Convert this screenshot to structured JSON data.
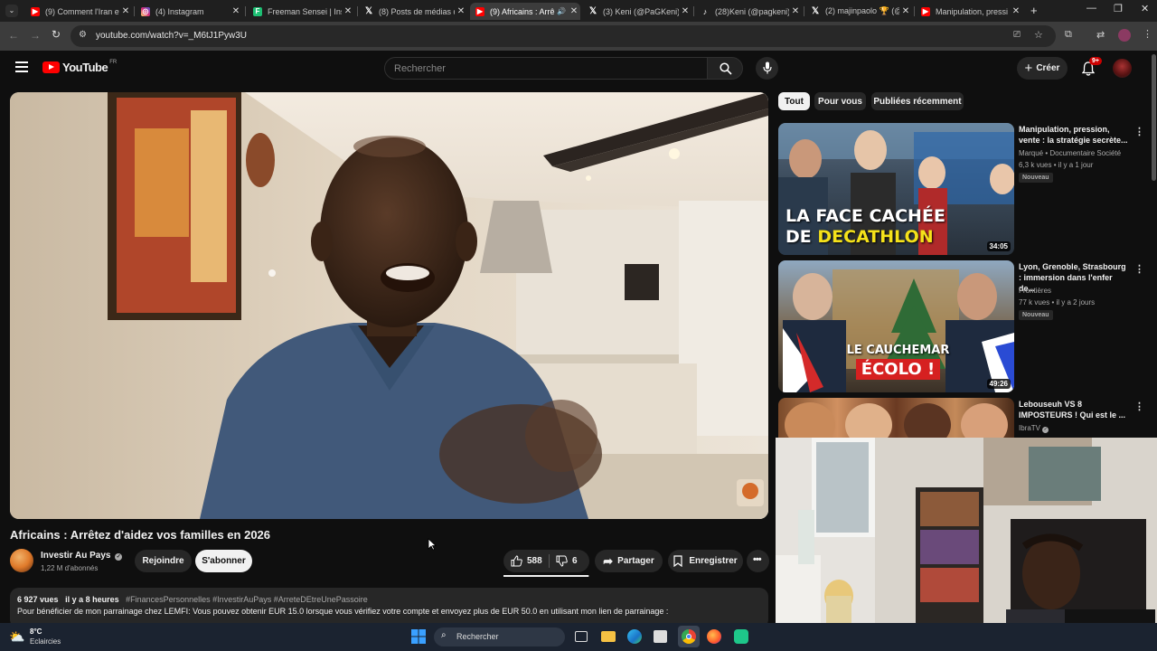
{
  "browser": {
    "tabs": [
      {
        "label": "(9) Comment l'Iran et",
        "icon": "youtube-icon",
        "color": "#ff0000"
      },
      {
        "label": "(4) Instagram",
        "icon": "instagram-icon",
        "color": "#d62976"
      },
      {
        "label": "Freeman Sensei | Inst",
        "icon": "green-app-icon",
        "color": "#1dbf73"
      },
      {
        "label": "(8) Posts de médias d",
        "icon": "x-icon",
        "color": "#000000"
      },
      {
        "label": "(9) Africains : Arrê",
        "icon": "youtube-icon",
        "color": "#ff0000"
      },
      {
        "label": "(3) Keni (@PaGKeni)",
        "icon": "x-icon",
        "color": "#000000"
      },
      {
        "label": "(28)Keni (@pagkeni)",
        "icon": "tiktok-icon",
        "color": "#000000"
      },
      {
        "label": "(2) majinpaolo 🏆 (@",
        "icon": "x-icon",
        "color": "#000000"
      },
      {
        "label": "Manipulation, pressi",
        "icon": "youtube-icon",
        "color": "#ff0000"
      }
    ],
    "url": "youtube.com/watch?v=_M6tJ1Pyw3U"
  },
  "youtube": {
    "logo_text": "YouTube",
    "region": "FR",
    "search_placeholder": "Rechercher",
    "create_label": "Créer",
    "notif_count": "9+",
    "chips": [
      "Tout",
      "Pour vous",
      "Publiées récemment"
    ],
    "video": {
      "title": "Africains : Arrêtez d'aidez vos familles en 2026",
      "channel": "Investir Au Pays",
      "subscribers": "1,22 M d'abonnés",
      "join_label": "Rejoindre",
      "subscribe_label": "S'abonner",
      "likes": "588",
      "dislikes": "6",
      "share_label": "Partager",
      "save_label": "Enregistrer",
      "views": "6 927 vues",
      "age": "il y a 8 heures",
      "hashtags": "#FinancesPersonnelles #InvestirAuPays #ArreteDEtreUnePassoire",
      "description": "Pour bénéficier de mon parrainage chez LEMFI: Vous pouvez obtenir EUR 15.0 lorsque vous vérifiez votre compte et envoyez plus de EUR 50.0 en utilisant mon lien de parrainage :"
    },
    "recommendations": [
      {
        "title": "Manipulation, pression, vente : la stratégie secrète...",
        "channel": "Marqué • Documentaire Société",
        "meta": "6,3 k vues • il y a 1 jour",
        "badge": "Nouveau",
        "duration": "34:05",
        "thumb_line1": "LA FACE CACHÉE",
        "thumb_line2": "DE ",
        "thumb_line2_accent": "DECATHLON"
      },
      {
        "title": "Lyon, Grenoble, Strasbourg : immersion dans l'enfer de...",
        "channel": "Frontières",
        "meta": "77 k vues • il y a 2 jours",
        "badge": "Nouveau",
        "duration": "49:26",
        "thumb_line1": "LE CAUCHEMAR",
        "thumb_line2": "ÉCOLO !"
      },
      {
        "title": "Lebouseuh VS 8 IMPOSTEURS ! Qui est le ...",
        "channel": "IbraTV",
        "meta": "",
        "badge": "",
        "duration": ""
      }
    ]
  },
  "taskbar": {
    "temperature": "8°C",
    "weather": "Eclaircies",
    "search_label": "Rechercher"
  }
}
